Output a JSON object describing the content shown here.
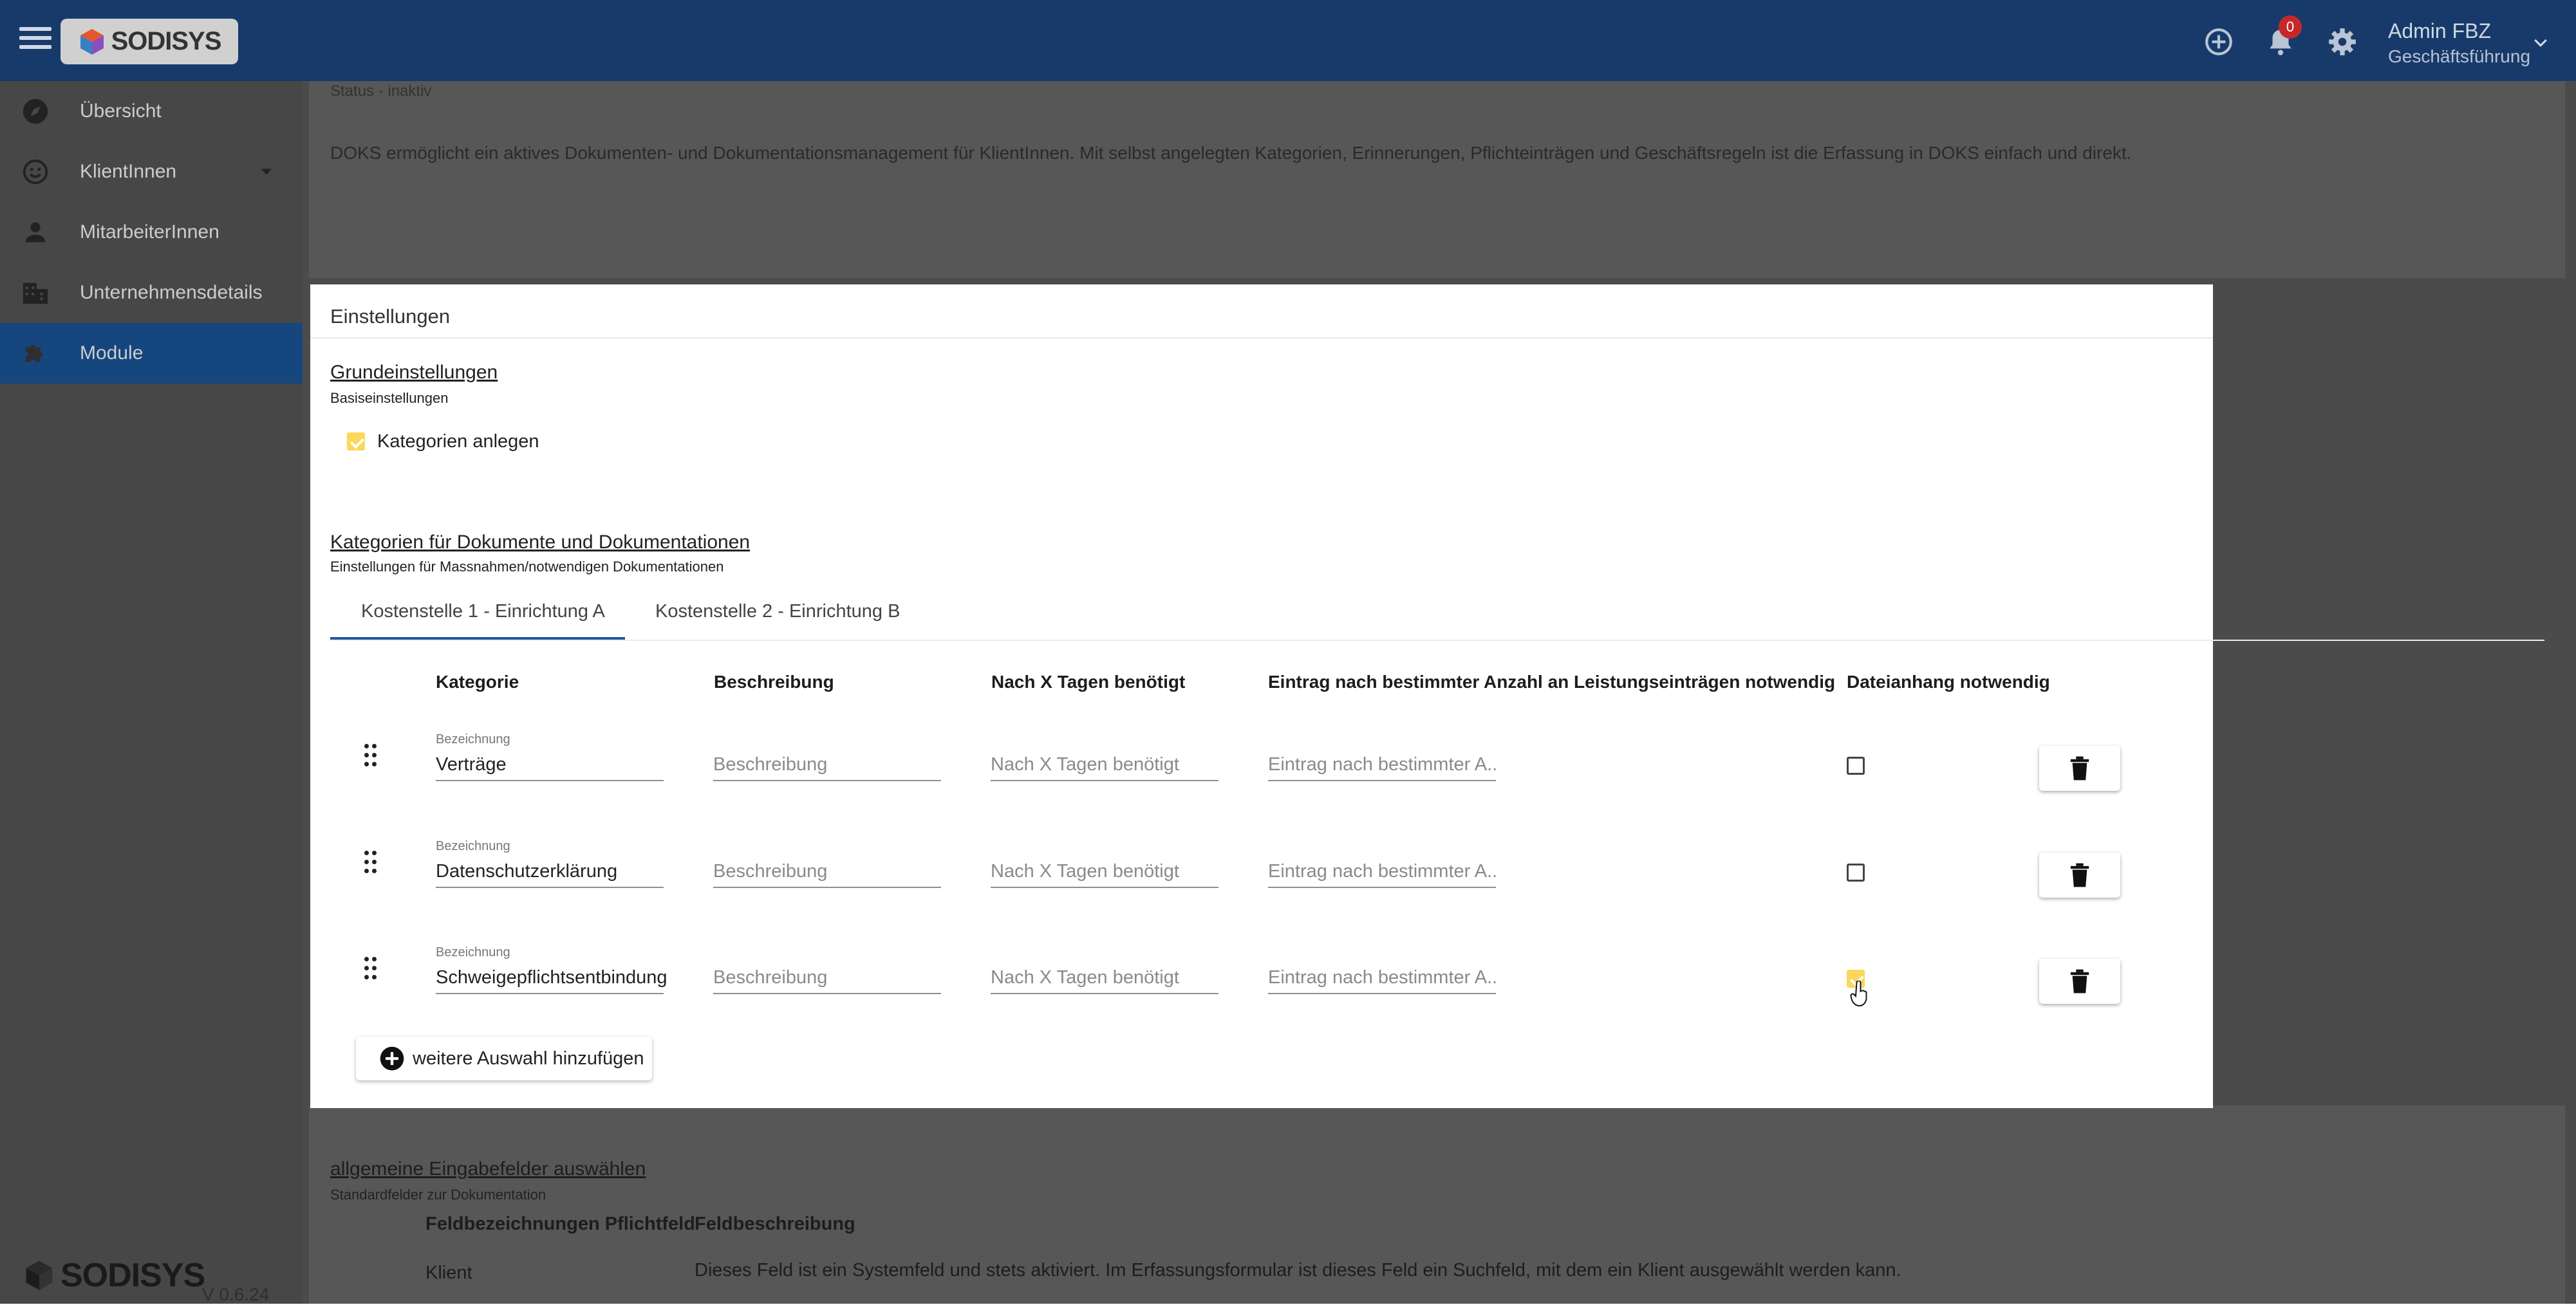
{
  "header": {
    "logo_text": "SODISYS",
    "notifications_count": "0",
    "user_name": "Admin FBZ",
    "user_role": "Geschäftsführung",
    "colors": {
      "bar": "#173a6a",
      "accent": "#15467e",
      "badge": "#c62828",
      "checkbox_checked": "#fbd75a"
    }
  },
  "sidebar": {
    "items": [
      {
        "label": "Übersicht",
        "icon": "compass-icon"
      },
      {
        "label": "KlientInnen",
        "icon": "smiley-icon"
      },
      {
        "label": "MitarbeiterInnen",
        "icon": "person-icon"
      },
      {
        "label": "Unternehmensdetails",
        "icon": "building-icon"
      },
      {
        "label": "Module",
        "icon": "puzzle-icon",
        "active": true
      }
    ],
    "footer_logo": "SODISYS",
    "version": "V 0.6.24"
  },
  "background": {
    "status": "Status - inaktiv",
    "intro": "DOKS ermöglicht ein aktives Dokumenten- und Dokumentationsmanagement für KlientInnen. Mit selbst angelegten Kategorien, Erinnerungen, Pflichteinträgen und Geschäftsregeln ist die Erfassung in DOKS einfach und direkt.",
    "section_title": "allgemeine Eingabefelder auswählen",
    "section_sub": "Standardfelder zur Dokumentation",
    "col_field": "Feldbezeichnungen Pflichtfeld",
    "col_desc": "Feldbeschreibung",
    "row_field": "Klient",
    "row_desc": "Dieses Feld ist ein Systemfeld und stets aktiviert. Im Erfassungsformular ist dieses Feld ein Suchfeld, mit dem ein Klient ausgewählt werden kann."
  },
  "modal": {
    "title": "Einstellungen",
    "basic": {
      "title": "Grundeinstellungen",
      "subtitle": "Basiseinstellungen",
      "checkbox_label": "Kategorien anlegen",
      "checked": true
    },
    "categories": {
      "title": "Kategorien für Dokumente und Dokumentationen",
      "subtitle": "Einstellungen für Massnahmen/notwendigen Dokumentationen",
      "tabs": [
        {
          "label": "Kostenstelle 1 - Einrichtung A",
          "active": true
        },
        {
          "label": "Kostenstelle 2 - Einrichtung B",
          "active": false
        }
      ],
      "columns": {
        "category": "Kategorie",
        "description": "Beschreibung",
        "days": "Nach X Tagen benötigt",
        "entry": "Eintrag nach bestimmter Anzahl an Leistungseinträgen notwendig",
        "attachment": "Dateianhang notwendig"
      },
      "field_label": "Bezeichnung",
      "placeholders": {
        "description": "Beschreibung",
        "days": "Nach X Tagen benötigt",
        "entry": "Eintrag nach bestimmter A..."
      },
      "rows": [
        {
          "name": "Verträge",
          "attachment": false
        },
        {
          "name": "Datenschutzerklärung",
          "attachment": false
        },
        {
          "name": "Schweigepflichtsentbindung",
          "attachment": true
        }
      ],
      "add_button": "weitere Auswahl hinzufügen"
    }
  }
}
